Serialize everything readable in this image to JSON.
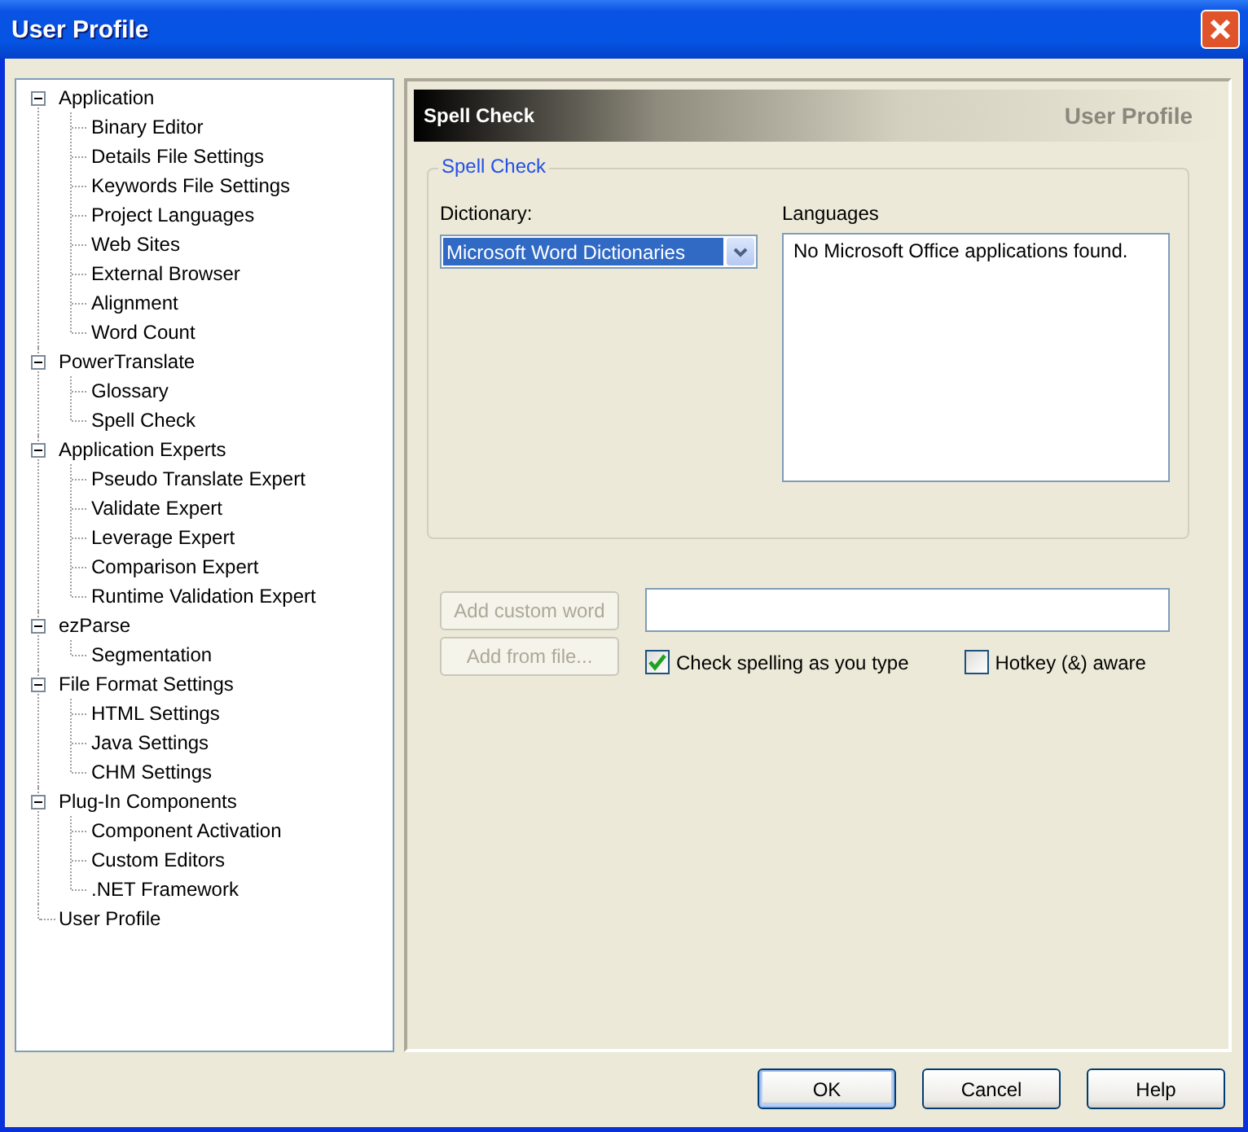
{
  "window": {
    "title": "User Profile"
  },
  "tree": [
    {
      "label": "Application",
      "expanded": true,
      "children": [
        {
          "label": "Binary Editor"
        },
        {
          "label": "Details File Settings"
        },
        {
          "label": "Keywords File Settings"
        },
        {
          "label": "Project Languages"
        },
        {
          "label": "Web Sites"
        },
        {
          "label": "External Browser"
        },
        {
          "label": "Alignment"
        },
        {
          "label": "Word Count"
        }
      ]
    },
    {
      "label": "PowerTranslate",
      "expanded": true,
      "children": [
        {
          "label": "Glossary"
        },
        {
          "label": "Spell Check"
        }
      ]
    },
    {
      "label": "Application Experts",
      "expanded": true,
      "children": [
        {
          "label": "Pseudo Translate Expert"
        },
        {
          "label": "Validate Expert"
        },
        {
          "label": "Leverage Expert"
        },
        {
          "label": "Comparison Expert"
        },
        {
          "label": "Runtime Validation Expert"
        }
      ]
    },
    {
      "label": "ezParse",
      "expanded": true,
      "children": [
        {
          "label": "Segmentation"
        }
      ]
    },
    {
      "label": "File Format Settings",
      "expanded": true,
      "children": [
        {
          "label": "HTML Settings"
        },
        {
          "label": "Java Settings"
        },
        {
          "label": "CHM Settings"
        }
      ]
    },
    {
      "label": "Plug-In Components",
      "expanded": true,
      "children": [
        {
          "label": "Component Activation"
        },
        {
          "label": "Custom Editors"
        },
        {
          "label": ".NET Framework"
        }
      ]
    },
    {
      "label": "User Profile"
    }
  ],
  "page_header": {
    "title": "Spell Check",
    "caption": "User Profile"
  },
  "group": {
    "legend": "Spell Check",
    "dictionary_label": "Dictionary:",
    "dictionary_value": "Microsoft Word Dictionaries",
    "languages_label": "Languages",
    "languages_text": "No Microsoft Office applications found."
  },
  "word_buttons": [
    {
      "label": "Add custom word",
      "disabled": true
    },
    {
      "label": "Add from file...",
      "disabled": true
    }
  ],
  "checkboxes": [
    {
      "label": "Check spelling as you type",
      "checked": true
    },
    {
      "label": "Hotkey (&) aware",
      "checked": false
    }
  ],
  "buttons": [
    {
      "label": "OK",
      "default": true
    },
    {
      "label": "Cancel",
      "default": false
    },
    {
      "label": "Help",
      "default": false
    }
  ]
}
